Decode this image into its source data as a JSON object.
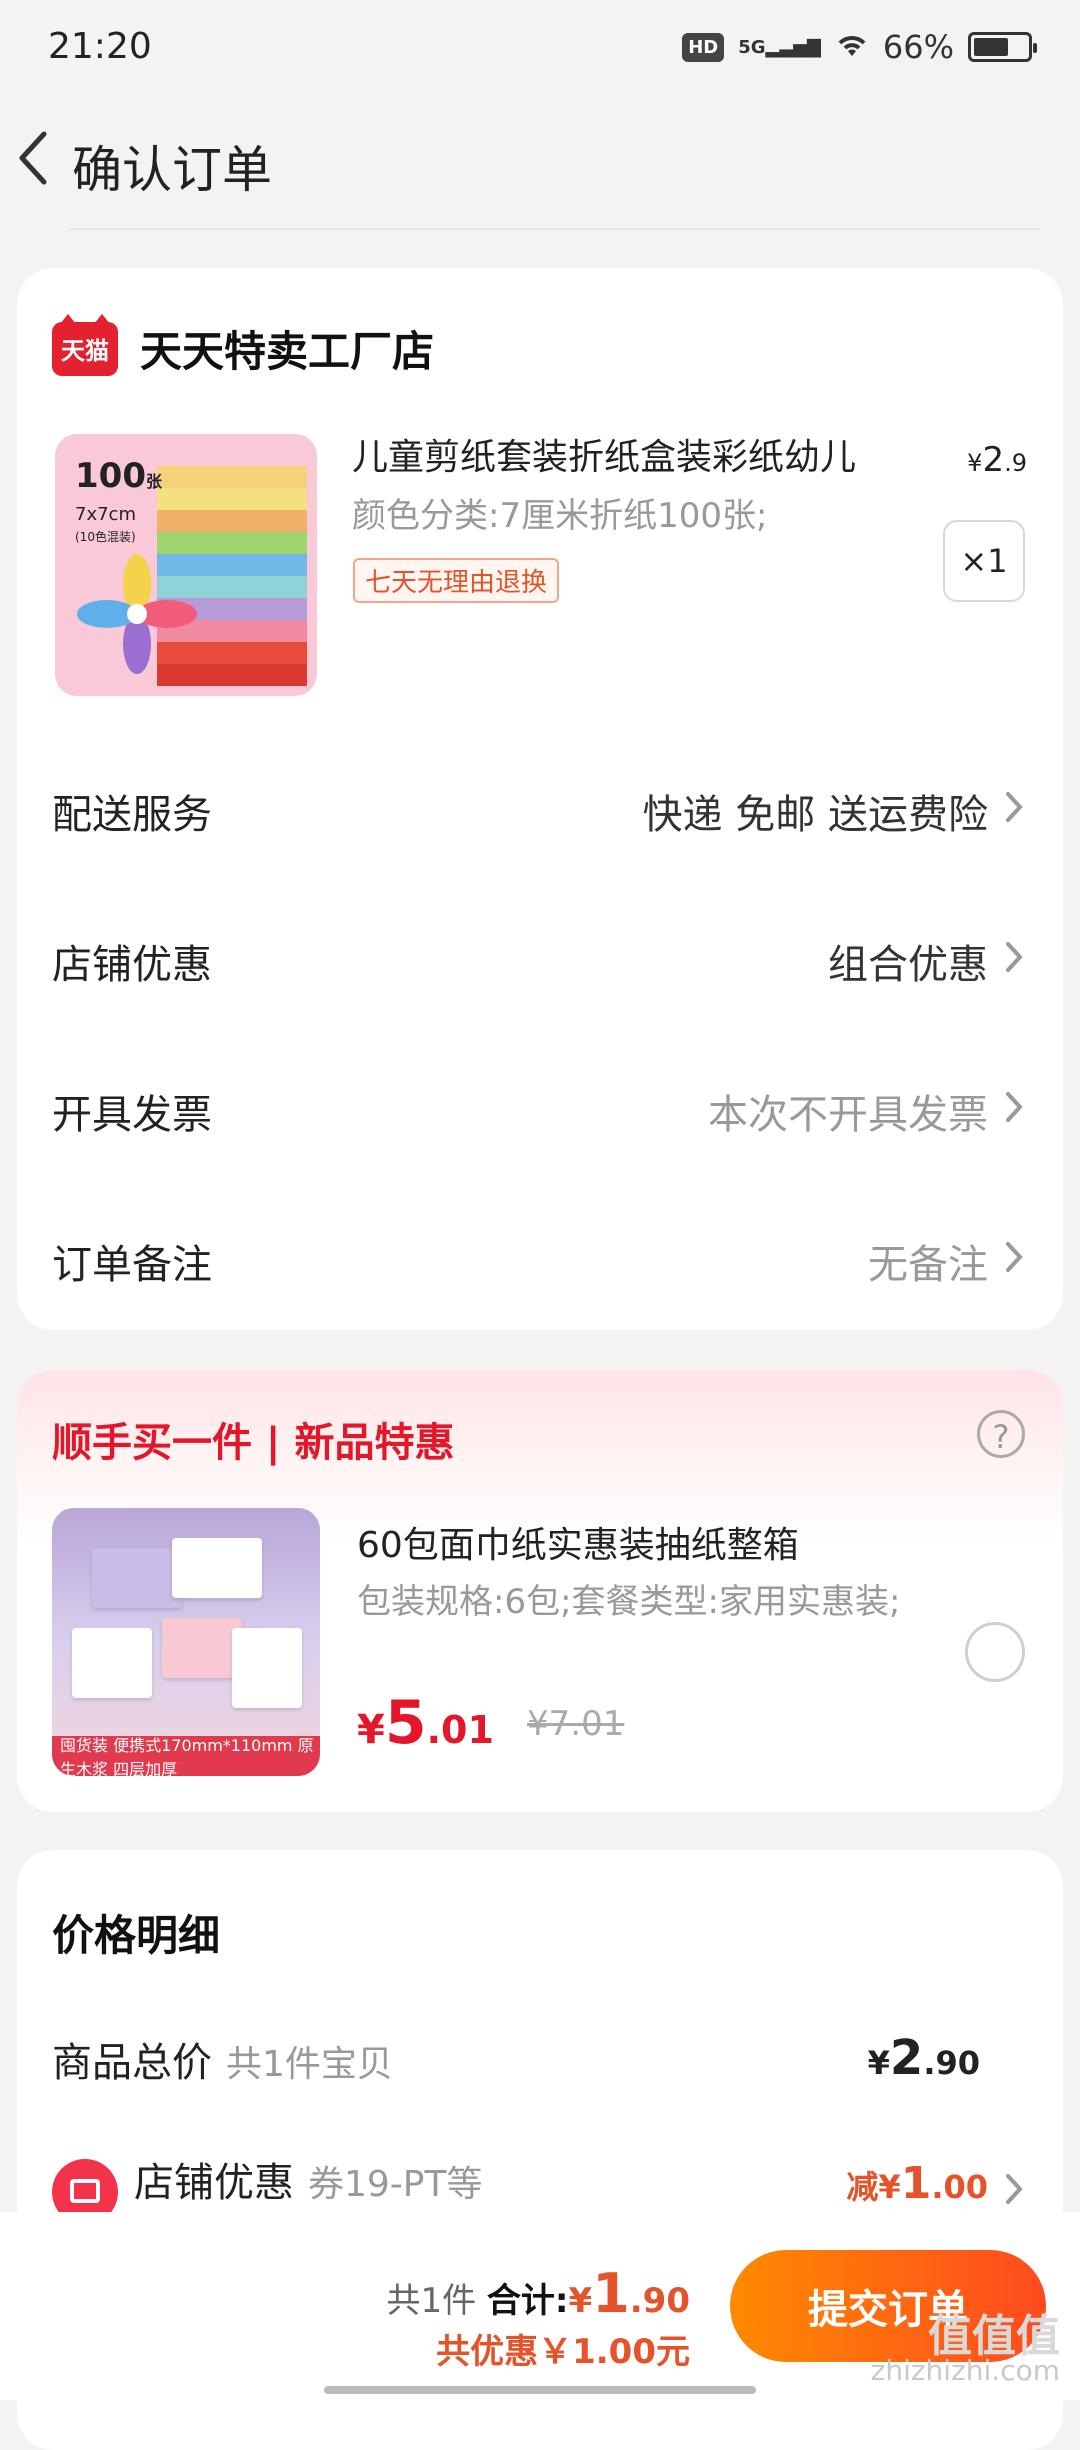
{
  "status_bar": {
    "time": "21:20",
    "battery": "66%",
    "battery_level": 0.66
  },
  "header": {
    "title": "确认订单"
  },
  "store": {
    "logo_text": "天猫",
    "name": "天天特卖工厂店"
  },
  "product": {
    "title": "儿童剪纸套装折纸盒装彩纸幼儿",
    "spec": "颜色分类:7厘米折纸100张;",
    "tag": "七天无理由退换",
    "price_yen": "¥",
    "price_int": "2",
    "price_dec": ".9",
    "quantity": "×1",
    "thumb_count": "100",
    "thumb_unit": "张",
    "thumb_size": "7x7cm",
    "thumb_note": "(10色混装)"
  },
  "order_rows": [
    {
      "label": "配送服务",
      "value": "快递 免邮 送运费险"
    },
    {
      "label": "店铺优惠",
      "value": "组合优惠"
    },
    {
      "label": "开具发票",
      "value": "本次不开具发票"
    },
    {
      "label": "订单备注",
      "value": "无备注"
    }
  ],
  "addon": {
    "title": "顺手买一件 | 新品特惠",
    "name": "60包面巾纸实惠装抽纸整箱",
    "spec": "包装规格:6包;套餐类型:家用实惠装;",
    "price_yen": "¥",
    "price_int": "5",
    "price_dec": ".01",
    "old_price": "¥7.01",
    "ribbon": "囤货装  便携式170mm*110mm  原生木浆 四层加厚"
  },
  "price_detail": {
    "title": "价格明细",
    "goods_label": "商品总价",
    "goods_sub": "共1件宝贝",
    "goods_yen": "¥",
    "goods_int": "2",
    "goods_dec": ".90",
    "discount_label": "店铺优惠",
    "discount_sub": "券19-PT等",
    "discount_pre": "减¥",
    "discount_int": "1",
    "discount_dec": ".00"
  },
  "bottom_bar": {
    "count_text": "共1件",
    "total_label": "合计:",
    "total_yen": "¥",
    "total_int": "1",
    "total_dec": ".90",
    "saved_text": "共优惠￥1.00元",
    "submit_label": "提交订单"
  },
  "watermark": {
    "line1": "值值值",
    "line2": "zhizhizhi.com"
  },
  "colors": {
    "accent": "#ff5a1f",
    "red": "#e4162a",
    "tmall": "#e4222f"
  }
}
